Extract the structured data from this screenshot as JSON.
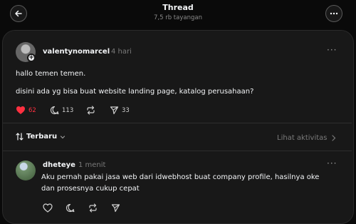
{
  "header": {
    "title": "Thread",
    "views": "7,5 rb tayangan"
  },
  "post": {
    "username": "valentynomarcel",
    "time": "4 hari",
    "line1": "hallo temen temen.",
    "line2": "disini ada yg bisa buat website landing page, katalog perusahaan?",
    "likes": "62",
    "comments": "113",
    "shares": "33",
    "like_color": "#ff3040"
  },
  "sort": {
    "label": "Terbaru"
  },
  "activity_label": "Lihat aktivitas",
  "reply": {
    "username": "dheteye",
    "time": "1 menit",
    "text_line1": "Aku pernah pakai jasa web dari idwebhost buat company profile, hasilnya oke",
    "text_line2": "dan prosesnya cukup cepat"
  },
  "icons": [
    "back-arrow-icon",
    "more-icon",
    "heart-icon",
    "comment-icon",
    "repost-icon",
    "send-icon",
    "sort-icon",
    "chevron-down-icon",
    "chevron-right-icon"
  ]
}
